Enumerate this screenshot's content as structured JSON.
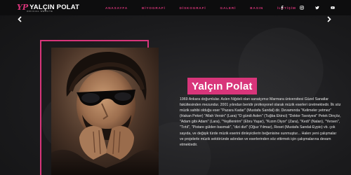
{
  "site": {
    "logo_mark": "YP",
    "logo_text": "YALÇIN POLAT",
    "logo_subtitle": "OFFICIAL WEBSITE"
  },
  "nav": {
    "items": [
      {
        "label": "ANASAYFA"
      },
      {
        "label": "BİYOGRAFİ"
      },
      {
        "label": "DİSKOGRAFİ"
      },
      {
        "label": "GALERİ"
      },
      {
        "label": "BASIN"
      },
      {
        "label": "İLETİŞİM"
      }
    ]
  },
  "social": {
    "icons": [
      "facebook-icon",
      "instagram-icon",
      "twitter-icon",
      "youtube-icon"
    ]
  },
  "colors": {
    "accent": "#d8357a",
    "header_bg": "#0d0d0e",
    "background": "#1b1b1d"
  },
  "slider": {
    "prev_icon": "chevron-left-icon",
    "next_icon": "chevron-right-icon"
  },
  "artist": {
    "name": "Yalçın Polat",
    "bio": "1969 Ankara doğumlular. Aslen Niğdeli olan sanatçımız Marmara üniversitesi Güzel Sanatlar fakültesinden mezundur. 2001 yılından beridir profesyonel olarak müzik eserleri üretmektedir. İlk söz müzik sahibi olduğu eser \"Pazara Kadar\" (Mustafa Sandal) dir. Devamında \"Kelimeler yetmez\" (Hakan Peker) \"Allah Versin\" (Lara) \"O gündi Aslen\" (Tuğba Ekinci) \"Doktor Tavsiyesi\" Petek Dinçöz, \"Adam gibi Adam\" (Lara), \"Yeşillenirim\" (Ebru Yaşar), \"Kızım Diyor\" (Zara), \"Kedi\" (Nalan), \"Yersen\", \"Tırtıl\", \"Pistare gülden basmalı\", \"dizi dizi\" (Oğuz Yılmaz), Reset (Mustafa Sandal-Eypio) vb. çok sayıda, ve değişik türde müzik eserini dinleyicilerin beğenisine sunmuştur... Halen yeni çalışmalar ve projelerle müzik sektöründe adından ve eserlerinden söz ettirmek için çalışmalarına devam etmektedir."
  }
}
